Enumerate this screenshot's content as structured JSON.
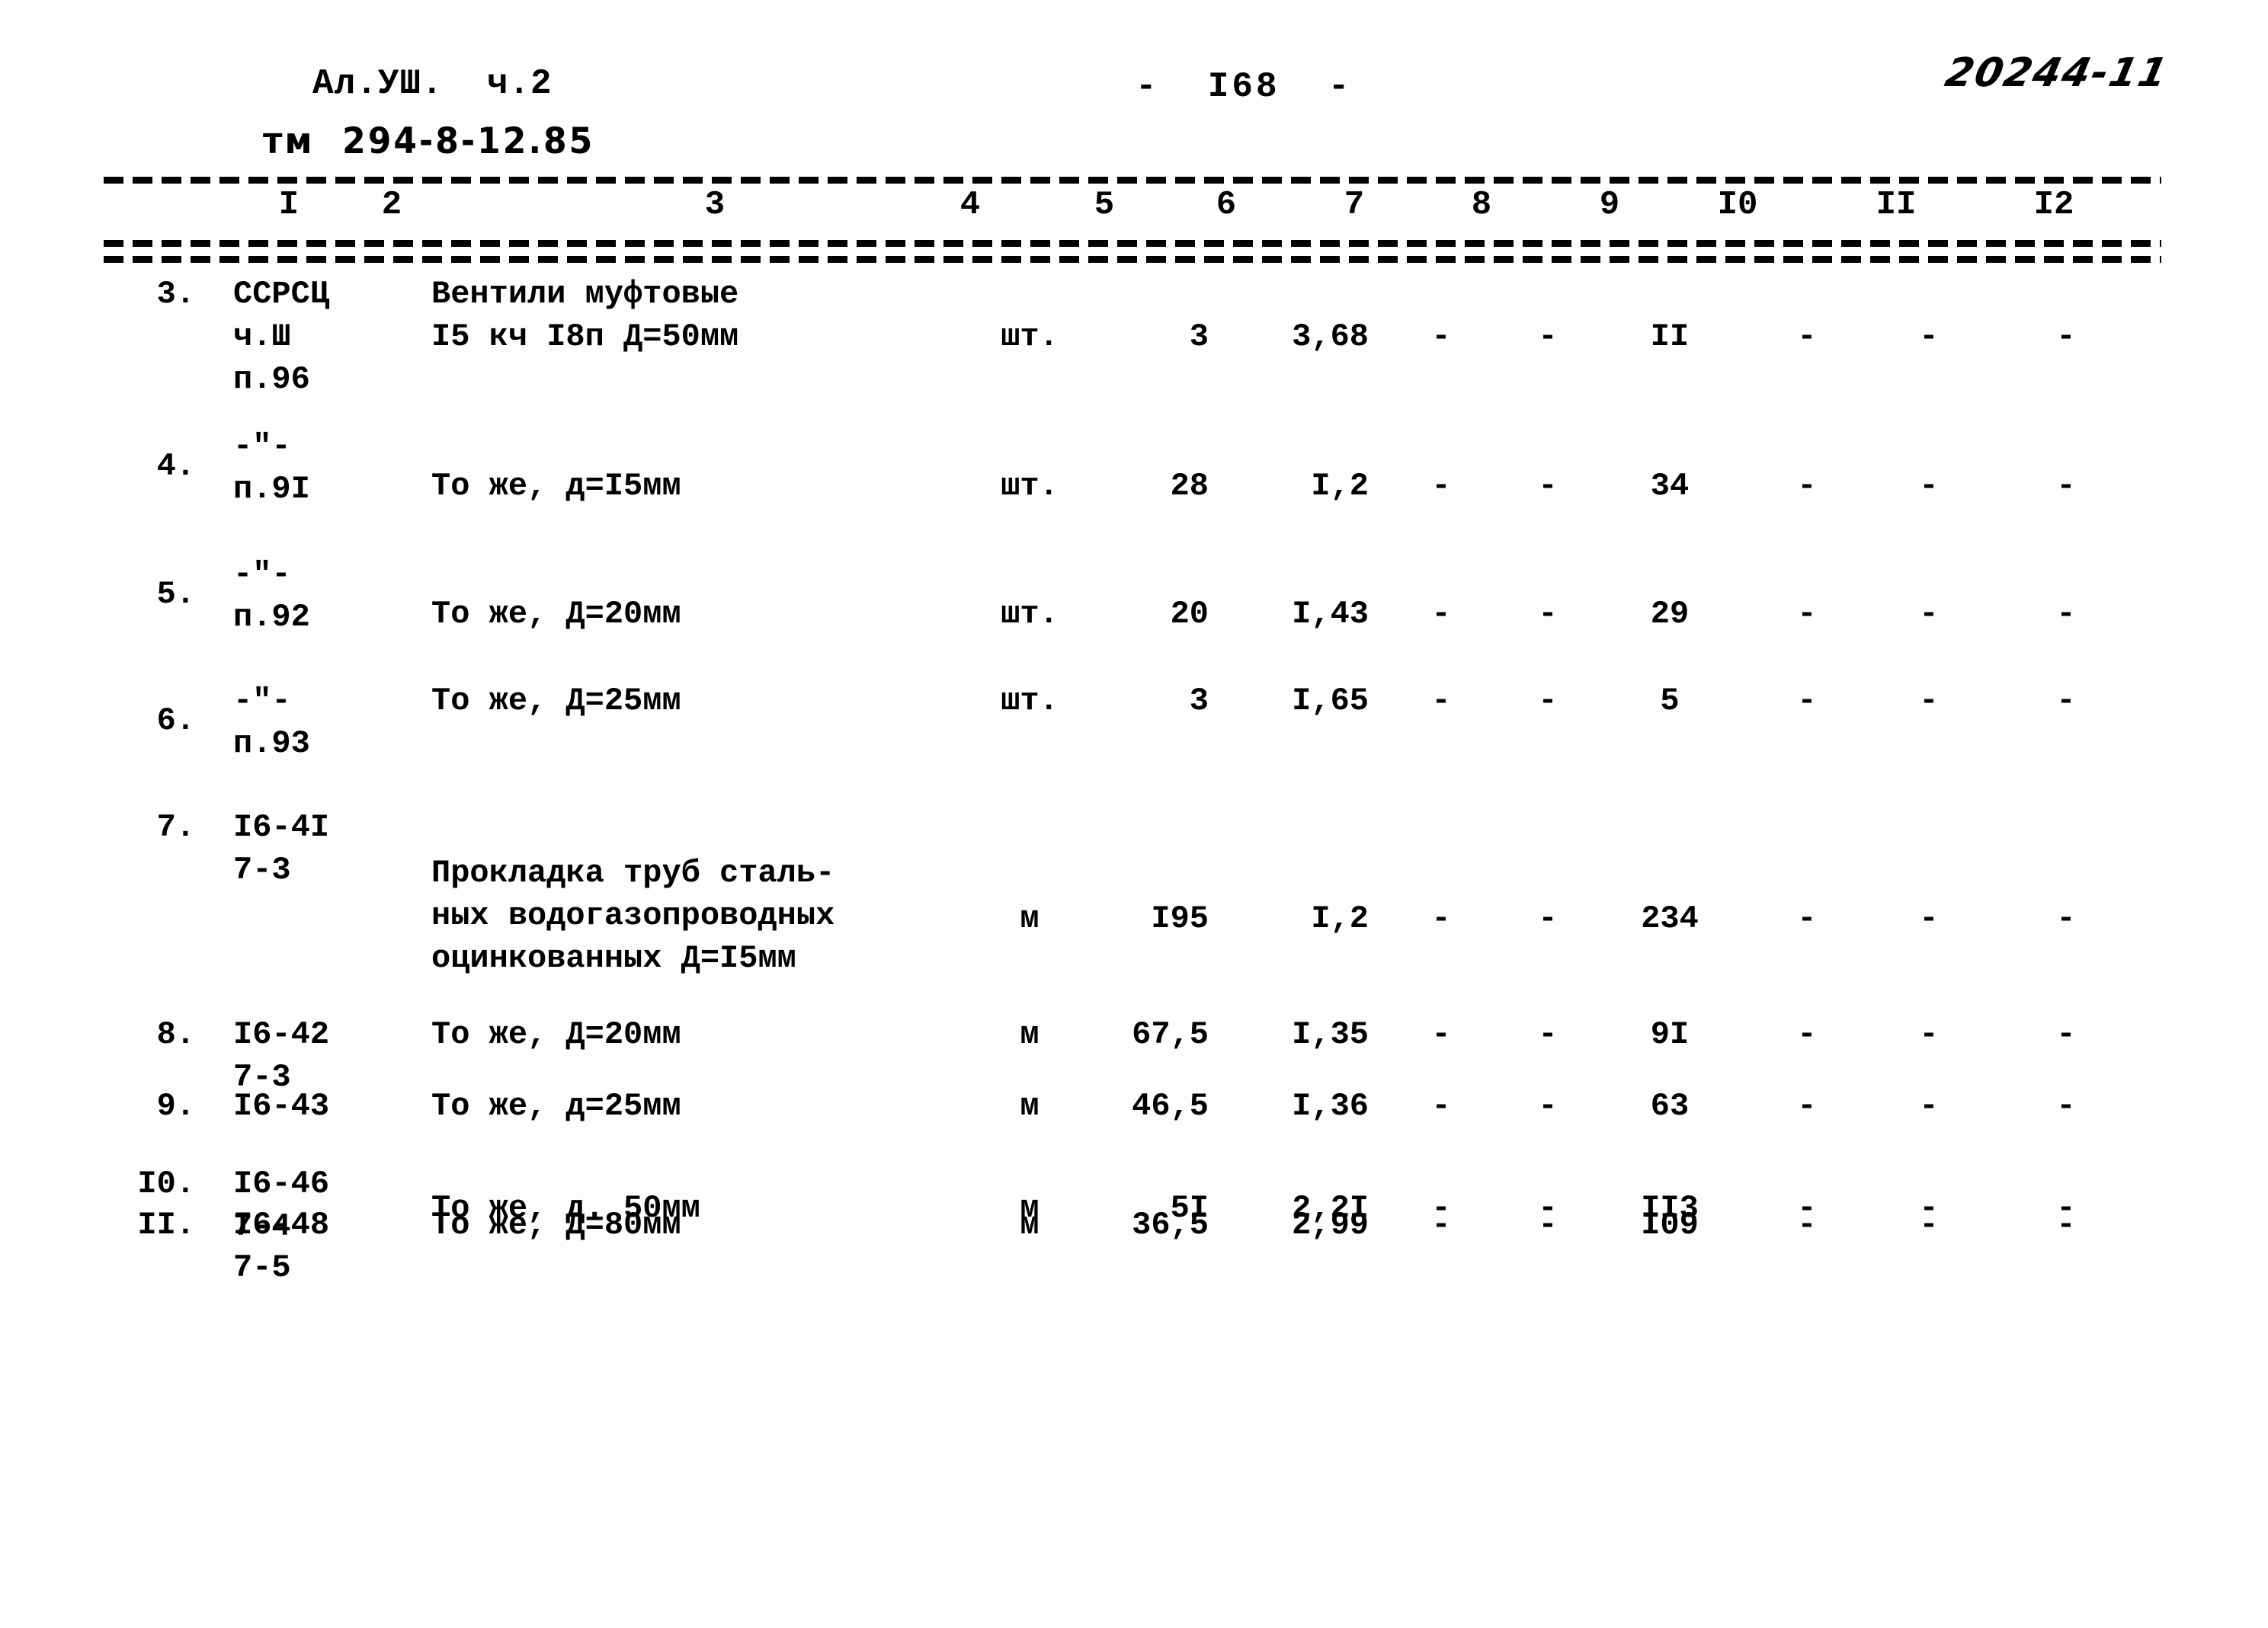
{
  "header": {
    "album_line": "Ал.УШ.  ч.2",
    "handwritten_code": "тм  294-8-12.85",
    "page_marker": "-  I68  -",
    "corner_stamp": "20244-11"
  },
  "table": {
    "column_headers": [
      "I",
      "2",
      "3",
      "4",
      "5",
      "6",
      "7",
      "8",
      "9",
      "I0",
      "II",
      "I2"
    ],
    "rows": [
      {
        "num": "3.",
        "code": "ССРСЦ\nч.Ш\nп.96",
        "desc": "Вентили муфтовые\nI5 кч I8п Д=50мм",
        "unit": "шт.",
        "v5": "3",
        "v6": "3,68",
        "v7": "-",
        "v8": "-",
        "v9": "II",
        "v10": "-",
        "v11": "-",
        "v12": "-"
      },
      {
        "num": "4.",
        "code": "-\"-\nп.9I",
        "desc": "То же, д=I5мм",
        "unit": "шт.",
        "v5": "28",
        "v6": "I,2",
        "v7": "-",
        "v8": "-",
        "v9": "34",
        "v10": "-",
        "v11": "-",
        "v12": "-"
      },
      {
        "num": "5.",
        "code": "-\"-\nп.92",
        "desc": "То же, Д=20мм",
        "unit": "шт.",
        "v5": "20",
        "v6": "I,43",
        "v7": "-",
        "v8": "-",
        "v9": "29",
        "v10": "-",
        "v11": "-",
        "v12": "-"
      },
      {
        "num": "6.",
        "code": "-\"-\nп.93",
        "desc": "То же, Д=25мм",
        "unit": "шт.",
        "v5": "3",
        "v6": "I,65",
        "v7": "-",
        "v8": "-",
        "v9": "5",
        "v10": "-",
        "v11": "-",
        "v12": "-"
      },
      {
        "num": "7.",
        "code": "I6-4I\n7-3",
        "desc": "Прокладка труб сталь-\nных водогазопроводных\nоцинкованных Д=I5мм",
        "unit": "м",
        "v5": "I95",
        "v6": "I,2",
        "v7": "-",
        "v8": "-",
        "v9": "234",
        "v10": "-",
        "v11": "-",
        "v12": "-"
      },
      {
        "num": "8.",
        "code": "I6-42\n7-3",
        "desc": "То же, Д=20мм",
        "unit": "м",
        "v5": "67,5",
        "v6": "I,35",
        "v7": "-",
        "v8": "-",
        "v9": "9I",
        "v10": "-",
        "v11": "-",
        "v12": "-"
      },
      {
        "num": "9.",
        "code": "I6-43",
        "desc": "То же, д=25мм",
        "unit": "м",
        "v5": "46,5",
        "v6": "I,36",
        "v7": "-",
        "v8": "-",
        "v9": "63",
        "v10": "-",
        "v11": "-",
        "v12": "-"
      },
      {
        "num": "I0.",
        "code": "I6-46\n7-4",
        "desc": "То же, д. 50мм",
        "unit": "м",
        "v5": "5I",
        "v6": "2,2I",
        "v7": "-",
        "v8": "-",
        "v9": "II3",
        "v10": "-",
        "v11": "-",
        "v12": "-"
      },
      {
        "num": "II.",
        "code": "I6-48\n7-5",
        "desc": "То же, Д=80мм",
        "unit": "м",
        "v5": "36,5",
        "v6": "2,99",
        "v7": "-",
        "v8": "-",
        "v9": "I09",
        "v10": "-",
        "v11": "-",
        "v12": "-"
      }
    ]
  }
}
